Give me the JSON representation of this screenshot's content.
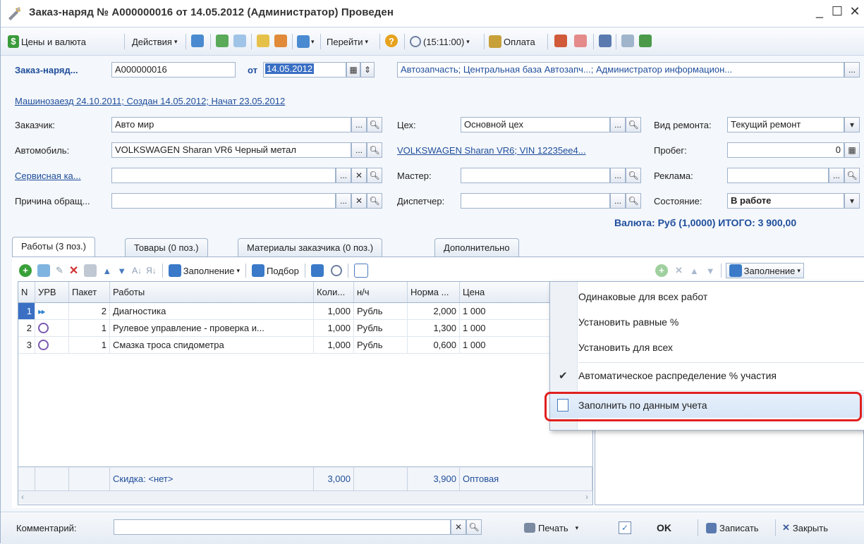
{
  "window": {
    "title": "Заказ-наряд № А000000016 от 14.05.2012 (Администратор) Проведен",
    "minimize": "_",
    "maximize": "☐",
    "close": "✕"
  },
  "toolbar": {
    "prices": "Цены и валюта",
    "actions": "Действия",
    "goto": "Перейти",
    "time": "(15:11:00)",
    "payment": "Оплата"
  },
  "header": {
    "doc_label": "Заказ-наряд...",
    "doc_number": "А000000016",
    "from_label": "от",
    "date": "14.05.2012",
    "org_info": "Автозапчасть; Центральная база Автозапч...; Администратор информацион...",
    "history_link": "Машинозаезд 24.10.2011; Создан 14.05.2012; Начат 23.05.2012",
    "customer_label": "Заказчик:",
    "customer_value": "Авто мир",
    "workshop_label": "Цех:",
    "workshop_value": "Основной цех",
    "repair_type_label": "Вид ремонта:",
    "repair_type_value": "Текущий ремонт",
    "car_label": "Автомобиль:",
    "car_value": "VOLKSWAGEN Sharan VR6 Черный метал",
    "car_link": "VOLKSWAGEN Sharan VR6; VIN 12235ee4...",
    "mileage_label": "Пробег:",
    "mileage_value": "0",
    "service_card_label": "Сервисная ка...",
    "master_label": "Мастер:",
    "ad_label": "Реклама:",
    "reason_label": "Причина обращ...",
    "dispatcher_label": "Диспетчер:",
    "state_label": "Состояние:",
    "state_value": "В работе",
    "total": "Валюта: Руб (1,0000) ИТОГО: 3 900,00"
  },
  "tabs": [
    {
      "label": "Работы (3 поз.)"
    },
    {
      "label": "Товары (0 поз.)"
    },
    {
      "label": "Материалы заказчика (0 поз.)"
    },
    {
      "label": "Дополнительно"
    }
  ],
  "grid_toolbar": {
    "fill": "Заполнение",
    "pick": "Подбор",
    "fill_right": "Заполнение"
  },
  "grid": {
    "columns": [
      "N",
      "УРВ",
      "Пакет",
      "Работы",
      "Коли...",
      "н/ч",
      "Норма ...",
      "Цена"
    ],
    "rows": [
      {
        "n": "1",
        "pack": "2",
        "work": "Диагностика",
        "qty": "1,000",
        "unit": "Рубль",
        "norm": "2,000",
        "price": "1 000"
      },
      {
        "n": "2",
        "pack": "1",
        "work": "Рулевое управление - проверка и...",
        "qty": "1,000",
        "unit": "Рубль",
        "norm": "1,300",
        "price": "1 000"
      },
      {
        "n": "3",
        "pack": "1",
        "work": "Смазка троса спидометра",
        "qty": "1,000",
        "unit": "Рубль",
        "norm": "0,600",
        "price": "1 000"
      }
    ],
    "footer": {
      "discount": "Скидка: <нет>",
      "qty_total": "3,000",
      "norm_total": "3,900",
      "price_type": "Оптовая"
    }
  },
  "menu": {
    "items": [
      {
        "label": "Одинаковые для всех работ"
      },
      {
        "label": "Установить равные %"
      },
      {
        "label": "Установить для всех"
      },
      {
        "label": "Автоматическое распределение % участия"
      },
      {
        "label": "Заполнить по данным учета"
      }
    ]
  },
  "bottom": {
    "comment_label": "Комментарий:",
    "print": "Печать",
    "ok": "OK",
    "save": "Записать",
    "close": "Закрыть"
  }
}
